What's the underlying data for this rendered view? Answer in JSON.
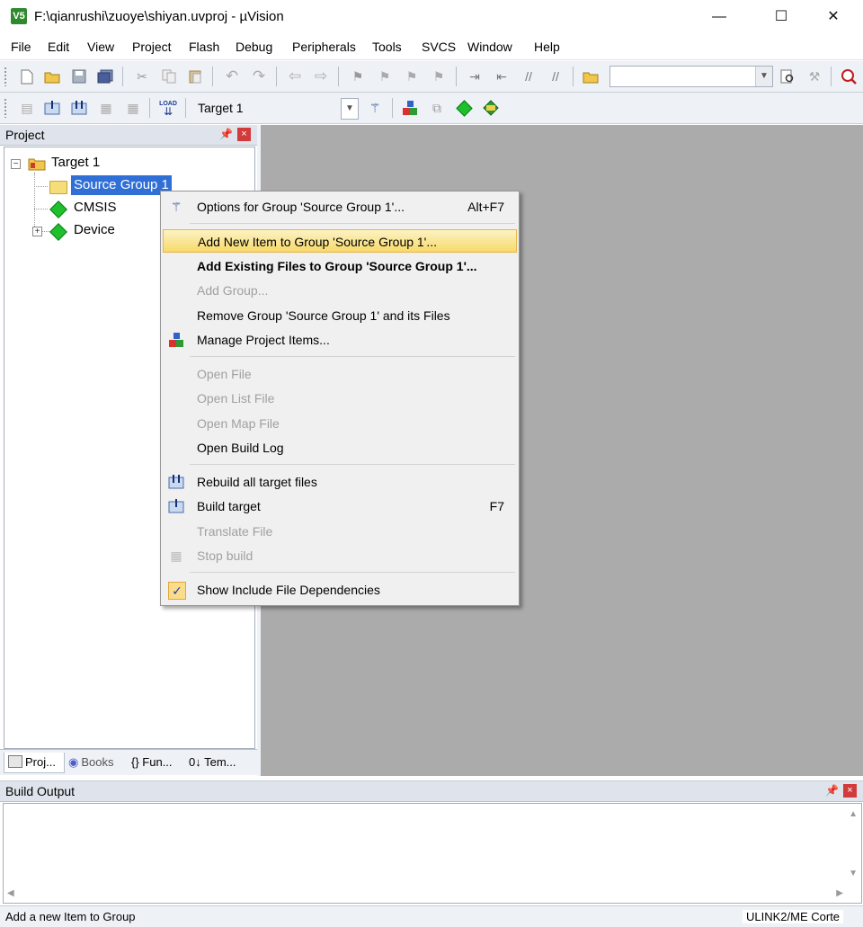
{
  "window": {
    "title": "F:\\qianrushi\\zuoye\\shiyan.uvproj - µVision",
    "minimize_glyph": "—",
    "maximize_glyph": "☐",
    "close_glyph": "✕",
    "app_icon_text": "V5"
  },
  "menubar": [
    "File",
    "Edit",
    "View",
    "Project",
    "Flash",
    "Debug",
    "Peripherals",
    "Tools",
    "SVCS",
    "Window",
    "Help"
  ],
  "toolbar2": {
    "target_select": "Target 1",
    "load_label": "LOAD"
  },
  "project_pane": {
    "title": "Project",
    "tree": [
      {
        "label": "Target 1",
        "expander": "⊟"
      },
      {
        "label": "Source Group 1",
        "selected": true
      },
      {
        "label": "CMSIS"
      },
      {
        "label": "Device",
        "expander": "⊞"
      }
    ],
    "tabs": [
      "Proj...",
      "Books",
      "{} Fun...",
      "0↓ Tem..."
    ]
  },
  "context_menu": {
    "items": [
      {
        "label": "Options for Group 'Source Group 1'...",
        "shortcut": "Alt+F7",
        "state": "normal",
        "icon": "options-wand-icon"
      },
      {
        "label": "Add New  Item to Group 'Source Group 1'...",
        "state": "highlighted"
      },
      {
        "label": "Add Existing Files to Group 'Source Group 1'...",
        "state": "bold"
      },
      {
        "label": "Add Group...",
        "state": "disabled"
      },
      {
        "label": "Remove Group 'Source Group 1' and its Files",
        "state": "normal"
      },
      {
        "label": "Manage Project Items...",
        "state": "normal",
        "icon": "manage-items-icon"
      },
      {
        "label": "Open File",
        "state": "disabled"
      },
      {
        "label": "Open List File",
        "state": "disabled"
      },
      {
        "label": "Open Map File",
        "state": "disabled"
      },
      {
        "label": "Open Build Log",
        "state": "normal"
      },
      {
        "label": "Rebuild all target files",
        "state": "normal",
        "icon": "rebuild-icon"
      },
      {
        "label": "Build target",
        "shortcut": "F7",
        "state": "normal",
        "icon": "build-icon"
      },
      {
        "label": "Translate File",
        "state": "disabled"
      },
      {
        "label": "Stop build",
        "state": "disabled",
        "icon": "stop-build-icon"
      },
      {
        "label": "Show Include File Dependencies",
        "state": "checked",
        "icon": "check-icon"
      }
    ]
  },
  "build_output": {
    "title": "Build Output"
  },
  "statusbar": {
    "message": "Add a new Item to Group",
    "debugger": "ULINK2/ME Corte"
  },
  "colors": {
    "workspace_bg": "#ababab",
    "selection": "#2f6fd6",
    "menu_highlight": "#f7d96a"
  }
}
